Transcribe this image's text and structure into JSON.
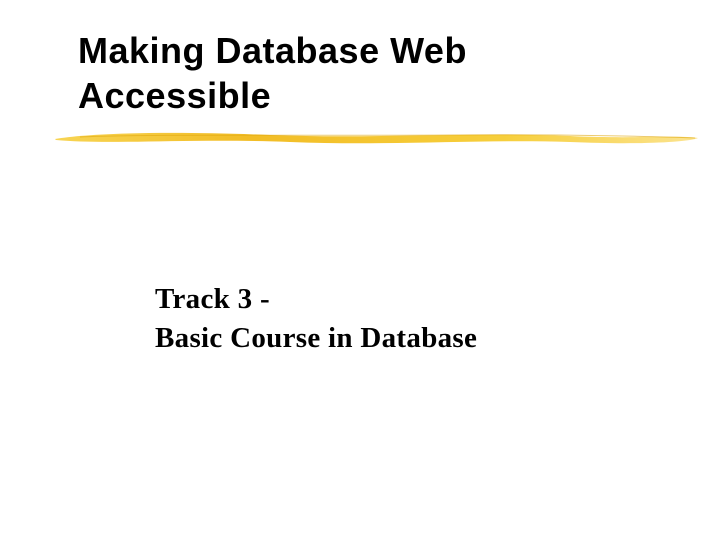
{
  "slide": {
    "title": "Making Database Web Accessible",
    "subtitle_line1": "Track 3 -",
    "subtitle_line2": "Basic Course in Database",
    "accent_color": "#f4c430"
  }
}
